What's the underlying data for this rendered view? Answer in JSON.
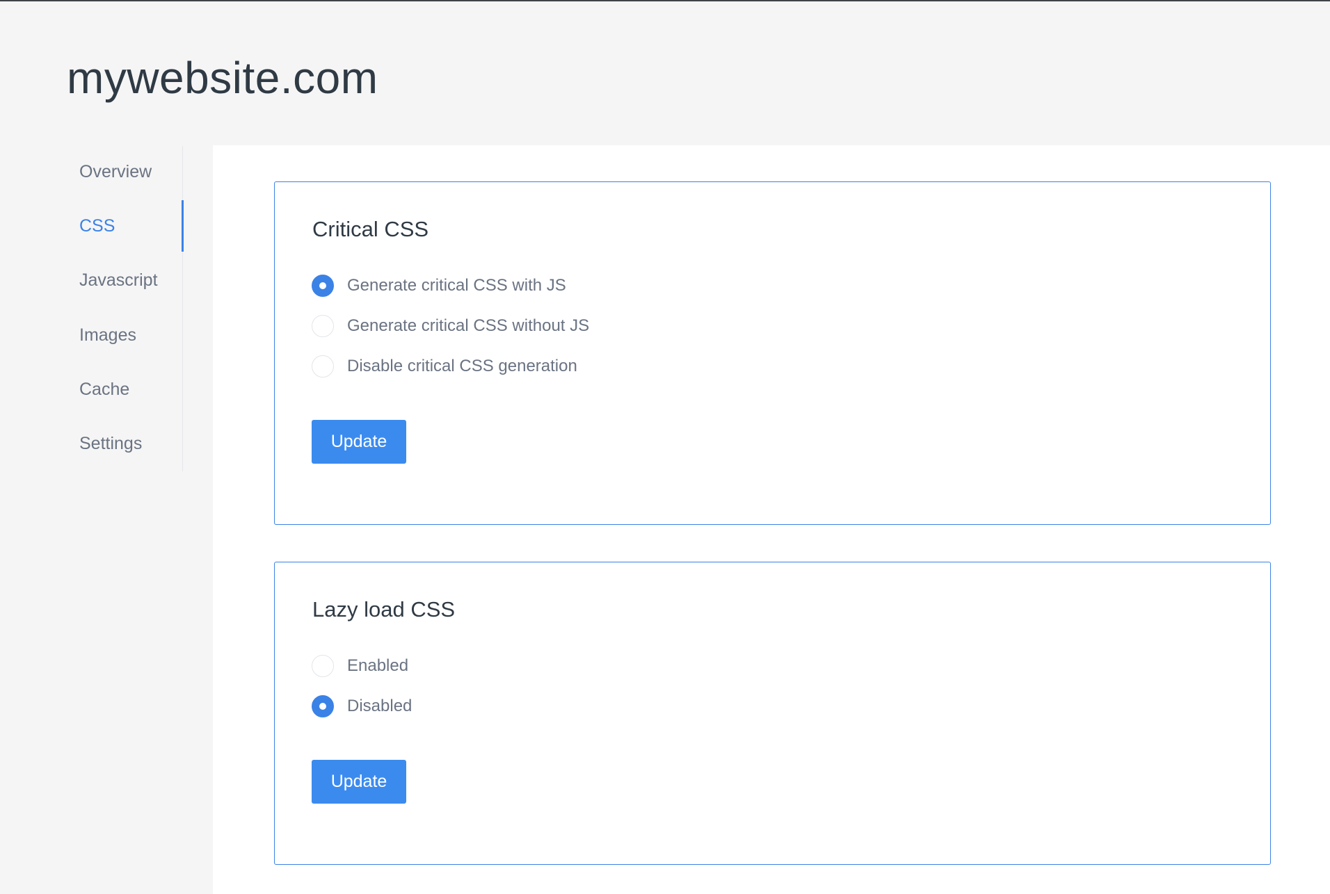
{
  "site": {
    "title": "mywebsite.com"
  },
  "sidebar": {
    "items": [
      {
        "label": "Overview",
        "active": false
      },
      {
        "label": "CSS",
        "active": true
      },
      {
        "label": "Javascript",
        "active": false
      },
      {
        "label": "Images",
        "active": false
      },
      {
        "label": "Cache",
        "active": false
      },
      {
        "label": "Settings",
        "active": false
      }
    ]
  },
  "critical_css": {
    "title": "Critical CSS",
    "options": [
      {
        "label": "Generate critical CSS with JS",
        "checked": true
      },
      {
        "label": "Generate critical CSS without JS",
        "checked": false
      },
      {
        "label": "Disable critical CSS generation",
        "checked": false
      }
    ],
    "button_label": "Update"
  },
  "lazy_load_css": {
    "title": "Lazy load CSS",
    "options": [
      {
        "label": "Enabled",
        "checked": false
      },
      {
        "label": "Disabled",
        "checked": true
      }
    ],
    "button_label": "Update"
  },
  "colors": {
    "accent": "#3b82e6",
    "button": "#3b8bef",
    "page_background": "#f5f5f5",
    "text_dark": "#2f3a44",
    "text_muted": "#6a7382"
  }
}
